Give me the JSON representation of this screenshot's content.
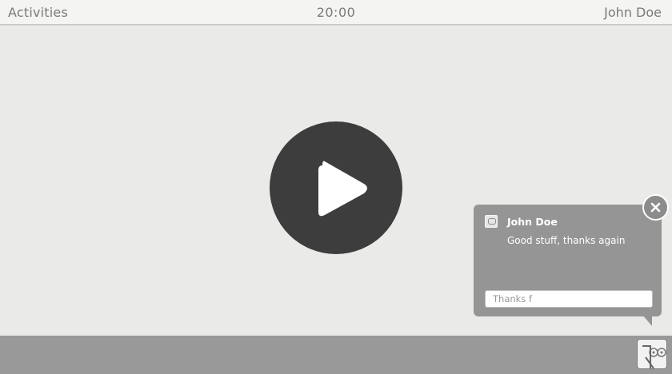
{
  "topbar": {
    "activities_label": "Activities",
    "clock": "20:00",
    "user_name": "John Doe"
  },
  "player": {
    "play_icon": "play-icon"
  },
  "notification": {
    "sender": "John Doe",
    "message": "Good stuff, thanks again",
    "reply_value": "Thanks f",
    "close_icon": "close-icon",
    "avatar_icon": "avatar-icon"
  },
  "tray": {
    "icon": "tray-app-icon"
  },
  "colors": {
    "topbar_bg": "#f4f4f3",
    "content_bg": "#eaebe8",
    "play_button": "#3d3d3d",
    "bottombar_bg": "#999999",
    "notification_bg": "#959595"
  }
}
